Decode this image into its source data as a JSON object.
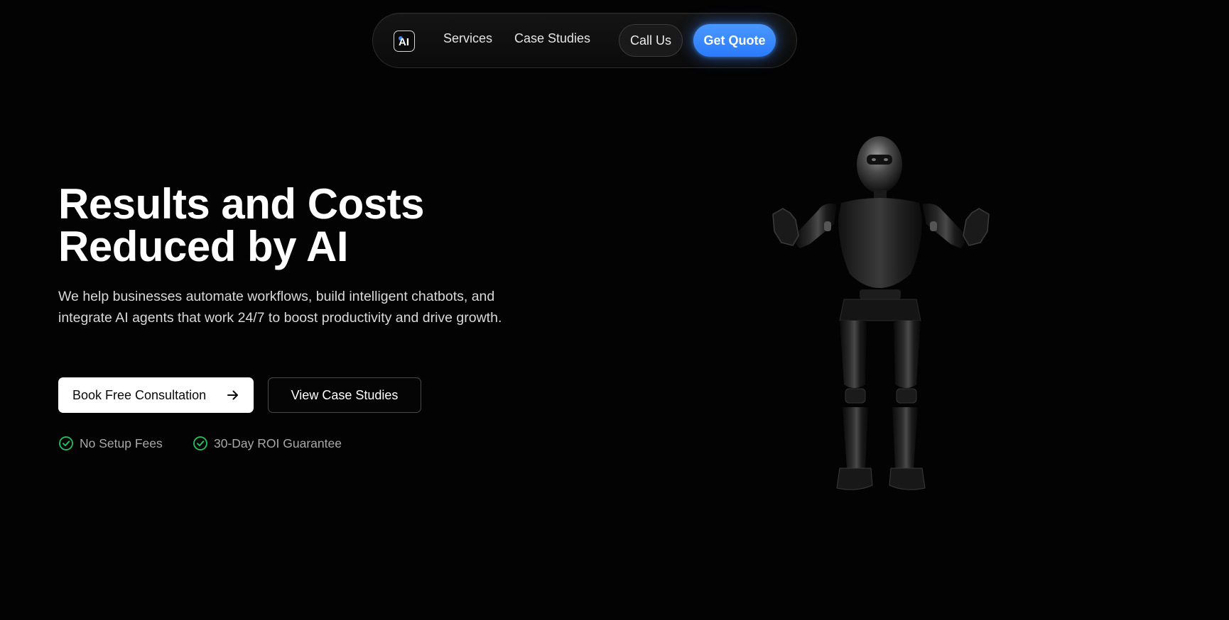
{
  "nav": {
    "logo_text": "AI",
    "links": [
      {
        "label": "Services"
      },
      {
        "label": "Case Studies"
      }
    ],
    "call_label": "Call Us",
    "quote_label": "Get Quote"
  },
  "hero": {
    "title_line_1": "Results and Costs",
    "title_line_2": "Reduced by AI",
    "description": "We help businesses automate workflows, build intelligent chatbots, and integrate AI agents that work 24/7 to boost productivity and drive growth.",
    "primary_cta": "Book Free Consultation",
    "secondary_cta": "View Case Studies",
    "features": [
      {
        "label": "No Setup Fees"
      },
      {
        "label": "30-Day ROI Guarantee"
      }
    ]
  },
  "colors": {
    "background": "#030303",
    "accent": "#2b7bff",
    "check": "#22c55e"
  },
  "icons": {
    "logo": "ai-logo-icon",
    "primary_cta": "arrow-right-icon",
    "feature": "check-circle-icon",
    "hero_image": "robot-illustration"
  }
}
